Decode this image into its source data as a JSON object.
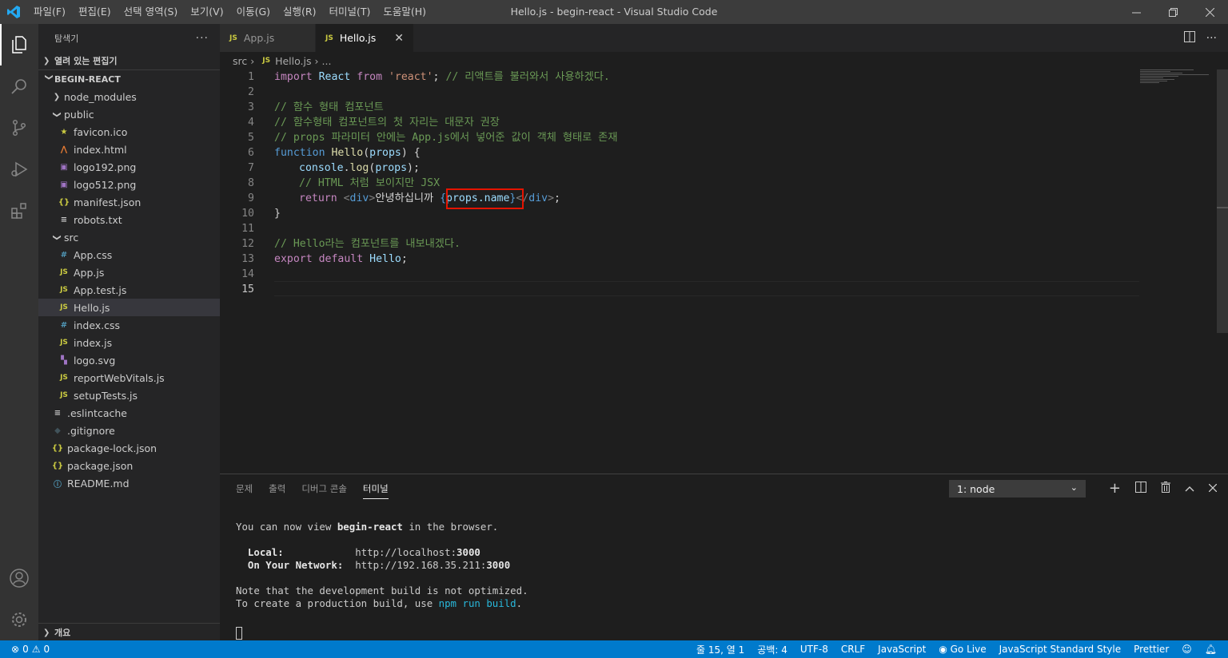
{
  "window": {
    "title": "Hello.js - begin-react - Visual Studio Code"
  },
  "menu": [
    "파일(F)",
    "편집(E)",
    "선택 영역(S)",
    "보기(V)",
    "이동(G)",
    "실행(R)",
    "터미널(T)",
    "도움말(H)"
  ],
  "sidebar": {
    "header": "탐색기",
    "open_editors": "열려 있는 편집기",
    "project": "BEGIN-REACT",
    "tree": [
      {
        "label": "node_modules",
        "type": "folder",
        "open": false
      },
      {
        "label": "public",
        "type": "folder",
        "open": true
      },
      {
        "label": "favicon.ico",
        "type": "fav"
      },
      {
        "label": "index.html",
        "type": "html"
      },
      {
        "label": "logo192.png",
        "type": "png"
      },
      {
        "label": "logo512.png",
        "type": "png"
      },
      {
        "label": "manifest.json",
        "type": "json"
      },
      {
        "label": "robots.txt",
        "type": "txt"
      },
      {
        "label": "src",
        "type": "folder",
        "open": true
      },
      {
        "label": "App.css",
        "type": "css"
      },
      {
        "label": "App.js",
        "type": "js"
      },
      {
        "label": "App.test.js",
        "type": "jst"
      },
      {
        "label": "Hello.js",
        "type": "js"
      },
      {
        "label": "index.css",
        "type": "css"
      },
      {
        "label": "index.js",
        "type": "js"
      },
      {
        "label": "logo.svg",
        "type": "svg"
      },
      {
        "label": "reportWebVitals.js",
        "type": "js"
      },
      {
        "label": "setupTests.js",
        "type": "js"
      },
      {
        "label": ".eslintcache",
        "type": "txt"
      },
      {
        "label": ".gitignore",
        "type": "git"
      },
      {
        "label": "package-lock.json",
        "type": "json"
      },
      {
        "label": "package.json",
        "type": "json"
      },
      {
        "label": "README.md",
        "type": "info"
      }
    ],
    "outline": "개요"
  },
  "tabs": [
    {
      "label": "App.js",
      "badge": "JS"
    },
    {
      "label": "Hello.js",
      "badge": "JS"
    }
  ],
  "breadcrumb": {
    "folder": "src",
    "file": "Hello.js",
    "more": "..."
  },
  "code": {
    "line_numbers": [
      "1",
      "2",
      "3",
      "4",
      "5",
      "6",
      "7",
      "8",
      "9",
      "10",
      "11",
      "12",
      "13",
      "14",
      "15"
    ],
    "l1_import": "import",
    "l1_react": "React",
    "l1_from": "from",
    "l1_str": "'react'",
    "l1_semi": ";",
    "l1_comment": "// 리액트를 불러와서 사용하겠다.",
    "l3": "// 함수 형태 컴포넌트",
    "l4": "// 함수형태 컴포넌트의 첫 자리는 대문자 권장",
    "l5": "// props 파라미터 안에는 App.js에서 넣어준 값이 객체 형태로 존재",
    "l6_function": "function",
    "l6_name": "Hello",
    "l6_open": "(",
    "l6_param": "props",
    "l6_close": ") {",
    "l7_console": "console",
    "l7_dot": ".",
    "l7_log": "log",
    "l7_open": "(",
    "l7_arg": "props",
    "l7_close": ");",
    "l8": "// HTML 처럼 보이지만 JSX",
    "l9_return": "return",
    "l9_lt": "<",
    "l9_div": "div",
    "l9_gt": ">",
    "l9_text": "안녕하십니까 ",
    "l9_expr_open": "{",
    "l9_expr": "props.name",
    "l9_expr_close": "}",
    "l9_close_lt": "</",
    "l9_close_div": "div",
    "l9_close_gt": ">",
    "l9_semi": ";",
    "l10": "}",
    "l12": "// Hello라는 컴포넌트를 내보내겠다.",
    "l13_export": "export",
    "l13_default": "default",
    "l13_name": "Hello",
    "l13_semi": ";"
  },
  "panel": {
    "tabs": [
      "문제",
      "출력",
      "디버그 콘솔",
      "터미널"
    ],
    "terminal_select": "1: node",
    "terminal": {
      "l1a": "You can now view ",
      "l1b": "begin-react",
      "l1c": " in the browser.",
      "l2_label": "Local:",
      "l2_url": "http://localhost:",
      "l2_port": "3000",
      "l3_label": "On Your Network:",
      "l3_url": "http://192.168.35.211:",
      "l3_port": "3000",
      "l4": "Note that the development build is not optimized.",
      "l5a": "To create a production build, use ",
      "l5b": "npm run build",
      "l5c": "."
    }
  },
  "status": {
    "errors": "0",
    "warnings": "0",
    "position": "줄 15, 열 1",
    "spaces": "공백: 4",
    "encoding": "UTF-8",
    "eol": "CRLF",
    "language": "JavaScript",
    "golive": "Go Live",
    "style": "JavaScript Standard Style",
    "prettier": "Prettier"
  },
  "colors": {
    "accent": "#007acc",
    "highlight_box": "#e51400"
  }
}
